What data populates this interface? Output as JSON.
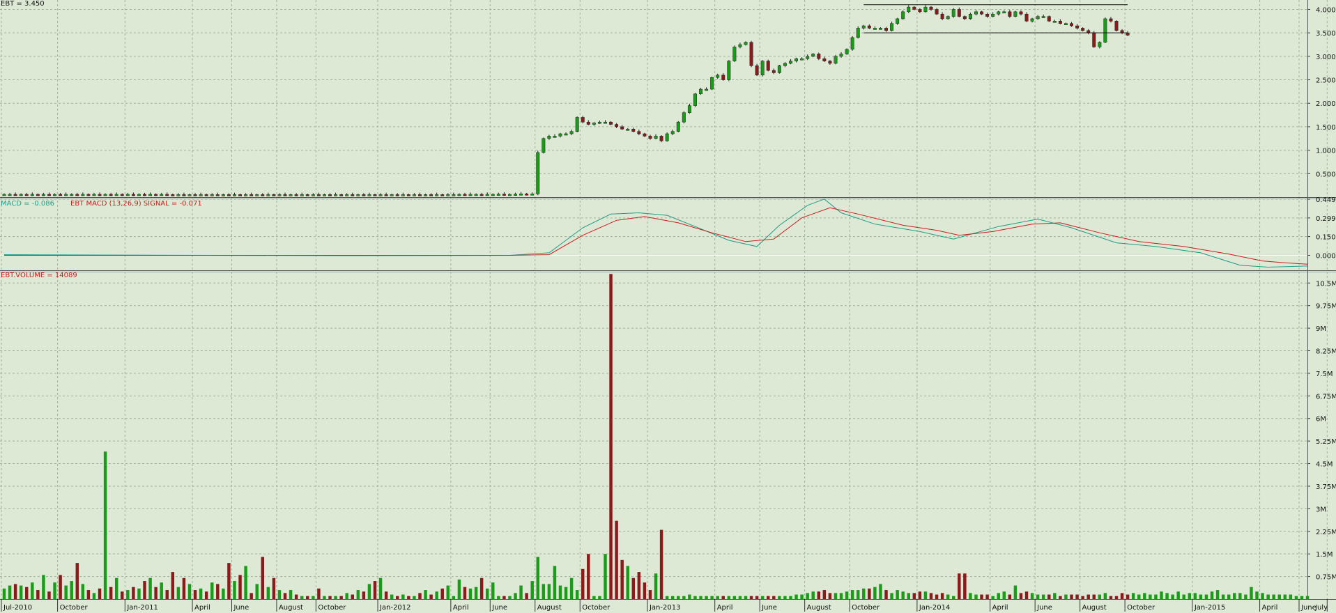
{
  "chart_data": [
    {
      "type": "candlestick",
      "label": "EBT = 3.450",
      "ylim": [
        0,
        4.2
      ],
      "y_ticks": [
        "4.000",
        "3.500",
        "3.000",
        "2.500",
        "2.000",
        "1.500",
        "1.000",
        "0.500"
      ],
      "y_tick_values": [
        4.0,
        3.5,
        3.0,
        2.5,
        2.0,
        1.5,
        1.0,
        0.5
      ],
      "grid": true,
      "resistance_line": {
        "value": 4.1,
        "start": 153,
        "end": 200
      },
      "support_line": {
        "value": 3.5,
        "start": 153,
        "end": 200
      },
      "weekly_close": [
        0.06,
        0.06,
        0.055,
        0.06,
        0.055,
        0.06,
        0.055,
        0.06,
        0.055,
        0.06,
        0.055,
        0.06,
        0.06,
        0.055,
        0.06,
        0.055,
        0.06,
        0.055,
        0.06,
        0.055,
        0.06,
        0.055,
        0.06,
        0.055,
        0.06,
        0.055,
        0.06,
        0.055,
        0.06,
        0.055,
        0.05,
        0.055,
        0.05,
        0.055,
        0.05,
        0.055,
        0.05,
        0.055,
        0.05,
        0.055,
        0.05,
        0.055,
        0.05,
        0.055,
        0.05,
        0.055,
        0.05,
        0.055,
        0.05,
        0.055,
        0.05,
        0.055,
        0.05,
        0.055,
        0.05,
        0.055,
        0.05,
        0.055,
        0.05,
        0.055,
        0.05,
        0.055,
        0.05,
        0.055,
        0.05,
        0.055,
        0.05,
        0.055,
        0.05,
        0.055,
        0.05,
        0.055,
        0.05,
        0.055,
        0.05,
        0.055,
        0.05,
        0.055,
        0.05,
        0.055,
        0.055,
        0.06,
        0.055,
        0.06,
        0.06,
        0.055,
        0.06,
        0.06,
        0.065,
        0.06,
        0.06,
        0.065,
        0.07,
        0.065,
        0.07,
        0.95,
        1.25,
        1.3,
        1.3,
        1.35,
        1.35,
        1.4,
        1.7,
        1.6,
        1.55,
        1.58,
        1.6,
        1.6,
        1.55,
        1.5,
        1.45,
        1.45,
        1.4,
        1.35,
        1.3,
        1.25,
        1.3,
        1.2,
        1.35,
        1.4,
        1.6,
        1.8,
        1.95,
        2.2,
        2.3,
        2.3,
        2.55,
        2.6,
        2.5,
        2.9,
        3.2,
        3.25,
        3.3,
        2.8,
        2.6,
        2.9,
        2.7,
        2.65,
        2.8,
        2.85,
        2.9,
        2.95,
        2.95,
        3.0,
        3.05,
        2.95,
        2.9,
        2.85,
        3.0,
        3.05,
        3.15,
        3.4,
        3.6,
        3.65,
        3.6,
        3.6,
        3.6,
        3.55,
        3.7,
        3.8,
        3.95,
        4.05,
        4.0,
        3.95,
        4.05,
        4.0,
        3.9,
        3.8,
        3.85,
        4.0,
        3.85,
        3.8,
        3.9,
        3.95,
        3.9,
        3.85,
        3.9,
        3.95,
        3.95,
        3.85,
        3.95,
        3.9,
        3.75,
        3.8,
        3.85,
        3.85,
        3.75,
        3.75,
        3.7,
        3.7,
        3.65,
        3.6,
        3.55,
        3.5,
        3.2,
        3.3,
        3.8,
        3.75,
        3.55,
        3.5,
        3.45
      ]
    },
    {
      "type": "line",
      "label": "MACD = -0.086",
      "label2": "EBT MACD (13,26,9) SIGNAL = -0.071",
      "ylim": [
        -0.12,
        0.46
      ],
      "y_ticks": [
        "0.449",
        "0.299",
        "0.150",
        "0.000"
      ],
      "y_tick_values": [
        0.449,
        0.299,
        0.15,
        0.0
      ],
      "series": [
        {
          "name": "MACD",
          "color": "#1e9c86",
          "points": [
            [
              0,
              0.005
            ],
            [
              60,
              -0.003
            ],
            [
              90,
              0.0
            ],
            [
              97,
              0.02
            ],
            [
              103,
              0.22
            ],
            [
              108,
              0.33
            ],
            [
              113,
              0.34
            ],
            [
              118,
              0.32
            ],
            [
              123,
              0.23
            ],
            [
              129,
              0.12
            ],
            [
              134,
              0.07
            ],
            [
              138,
              0.24
            ],
            [
              143,
              0.4
            ],
            [
              146,
              0.45
            ],
            [
              149,
              0.34
            ],
            [
              155,
              0.25
            ],
            [
              163,
              0.19
            ],
            [
              169,
              0.13
            ],
            [
              177,
              0.23
            ],
            [
              184,
              0.29
            ],
            [
              190,
              0.22
            ],
            [
              198,
              0.1
            ],
            [
              205,
              0.07
            ],
            [
              213,
              0.02
            ],
            [
              220,
              -0.08
            ],
            [
              225,
              -0.095
            ],
            [
              232,
              -0.086
            ]
          ]
        },
        {
          "name": "SIGNAL",
          "color": "#cc1b1b",
          "points": [
            [
              0,
              0.0
            ],
            [
              60,
              0.0
            ],
            [
              90,
              0.0
            ],
            [
              97,
              0.005
            ],
            [
              103,
              0.16
            ],
            [
              109,
              0.28
            ],
            [
              114,
              0.31
            ],
            [
              120,
              0.26
            ],
            [
              126,
              0.18
            ],
            [
              132,
              0.11
            ],
            [
              137,
              0.13
            ],
            [
              142,
              0.3
            ],
            [
              147,
              0.38
            ],
            [
              152,
              0.33
            ],
            [
              160,
              0.24
            ],
            [
              166,
              0.2
            ],
            [
              170,
              0.16
            ],
            [
              176,
              0.19
            ],
            [
              183,
              0.25
            ],
            [
              188,
              0.26
            ],
            [
              195,
              0.18
            ],
            [
              202,
              0.11
            ],
            [
              210,
              0.07
            ],
            [
              218,
              0.01
            ],
            [
              224,
              -0.045
            ],
            [
              228,
              -0.06
            ],
            [
              232,
              -0.071
            ]
          ]
        }
      ]
    },
    {
      "type": "bar",
      "label": "EBT.VOLUME = 14089",
      "ylim": [
        0,
        10.9
      ],
      "y_ticks": [
        "10.5M",
        "9.75M",
        "9M",
        "8.25M",
        "7.5M",
        "6.75M",
        "6M",
        "5.25M",
        "4.5M",
        "3.75M",
        "3M",
        "2.25M",
        "1.5M",
        "0.75M"
      ],
      "y_tick_values": [
        10.5,
        9.75,
        9.0,
        8.25,
        7.5,
        6.75,
        6.0,
        5.25,
        4.5,
        3.75,
        3.0,
        2.25,
        1.5,
        0.75
      ],
      "unit": "M",
      "weekly_volume": [
        0.35,
        0.45,
        0.5,
        0.45,
        0.4,
        0.55,
        0.3,
        0.8,
        0.25,
        0.55,
        0.8,
        0.45,
        0.6,
        1.2,
        0.5,
        0.3,
        0.2,
        0.35,
        4.9,
        0.4,
        0.7,
        0.25,
        0.3,
        0.4,
        0.35,
        0.6,
        0.7,
        0.4,
        0.55,
        0.3,
        0.9,
        0.4,
        0.7,
        0.5,
        0.3,
        0.35,
        0.25,
        0.55,
        0.5,
        0.35,
        1.2,
        0.6,
        0.8,
        1.1,
        0.2,
        0.5,
        1.4,
        0.4,
        0.7,
        0.3,
        0.2,
        0.3,
        0.15,
        0.1,
        0.1,
        0.1,
        0.35,
        0.1,
        0.1,
        0.1,
        0.1,
        0.2,
        0.15,
        0.3,
        0.25,
        0.5,
        0.6,
        0.7,
        0.25,
        0.15,
        0.1,
        0.15,
        0.1,
        0.1,
        0.2,
        0.3,
        0.15,
        0.25,
        0.35,
        0.45,
        0.1,
        0.65,
        0.4,
        0.35,
        0.4,
        0.7,
        0.35,
        0.55,
        0.1,
        0.1,
        0.1,
        0.2,
        0.45,
        0.2,
        0.6,
        1.4,
        0.5,
        0.5,
        1.1,
        0.45,
        0.4,
        0.7,
        0.3,
        1.0,
        1.5,
        0.1,
        0.1,
        1.5,
        10.8,
        2.6,
        1.3,
        1.1,
        0.7,
        0.9,
        0.55,
        0.3,
        0.85,
        2.3,
        0.1,
        0.1,
        0.1,
        0.1,
        0.15,
        0.1,
        0.1,
        0.1,
        0.1,
        0.1,
        0.1,
        0.1,
        0.1,
        0.1,
        0.1,
        0.1,
        0.1,
        0.1,
        0.1,
        0.1,
        0.1,
        0.1,
        0.1,
        0.15,
        0.15,
        0.2,
        0.25,
        0.25,
        0.3,
        0.2,
        0.2,
        0.2,
        0.25,
        0.3,
        0.3,
        0.35,
        0.35,
        0.4,
        0.5,
        0.3,
        0.2,
        0.3,
        0.25,
        0.2,
        0.2,
        0.25,
        0.25,
        0.2,
        0.15,
        0.2,
        0.15,
        0.1,
        0.85,
        0.85,
        0.2,
        0.15,
        0.15,
        0.15,
        0.1,
        0.2,
        0.25,
        0.15,
        0.45,
        0.2,
        0.25,
        0.2,
        0.15,
        0.15,
        0.15,
        0.2,
        0.1,
        0.15,
        0.15,
        0.15,
        0.1,
        0.15,
        0.15,
        0.15,
        0.2,
        0.1,
        0.1,
        0.2,
        0.15,
        0.2,
        0.15,
        0.2,
        0.15,
        0.15,
        0.25,
        0.2,
        0.15,
        0.25,
        0.15,
        0.2,
        0.2,
        0.15,
        0.15,
        0.25,
        0.3,
        0.15,
        0.15,
        0.2,
        0.2,
        0.15,
        0.4,
        0.25,
        0.2,
        0.15,
        0.15,
        0.15,
        0.15,
        0.15,
        0.1,
        0.1,
        0.1
      ]
    }
  ],
  "x_axis": {
    "week_count": 232,
    "ticks": [
      {
        "label": "Jul-2010",
        "week": 0
      },
      {
        "label": "October",
        "week": 10
      },
      {
        "label": "Jan-2011",
        "week": 22
      },
      {
        "label": "April",
        "week": 34
      },
      {
        "label": "June",
        "week": 41
      },
      {
        "label": "August",
        "week": 49
      },
      {
        "label": "October",
        "week": 56
      },
      {
        "label": "Jan-2012",
        "week": 67
      },
      {
        "label": "April",
        "week": 80
      },
      {
        "label": "June",
        "week": 87
      },
      {
        "label": "August",
        "week": 95
      },
      {
        "label": "October",
        "week": 103
      },
      {
        "label": "Jan-2013",
        "week": 115
      },
      {
        "label": "April",
        "week": 127
      },
      {
        "label": "June",
        "week": 135
      },
      {
        "label": "August",
        "week": 143
      },
      {
        "label": "October",
        "week": 151
      },
      {
        "label": "Jan-2014",
        "week": 163
      },
      {
        "label": "April",
        "week": 176
      },
      {
        "label": "June",
        "week": 184
      },
      {
        "label": "August",
        "week": 192
      },
      {
        "label": "October",
        "week": 200
      },
      {
        "label": "Jan-2015",
        "week": 212
      },
      {
        "label": "April",
        "week": 224
      },
      {
        "label": "June",
        "week": 231
      },
      {
        "label": "July",
        "week": 236
      }
    ]
  },
  "colors": {
    "background": "#dde8d5",
    "up": "#1a9c1a",
    "down": "#8b1a1a",
    "grid": "#9fb19a",
    "axis_text": "#111111",
    "macd_label": "#1e9c86",
    "signal_label": "#cc1b1b",
    "volume_label": "#cc1b1b"
  }
}
